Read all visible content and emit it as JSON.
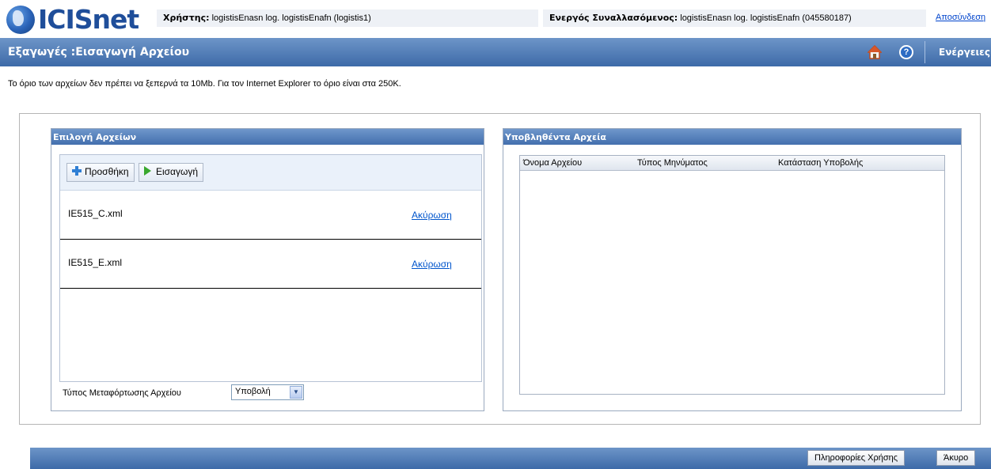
{
  "header": {
    "logo_text": "ICISnet",
    "user_label": "Χρήστης:",
    "user_value": "logistisEnasn log. logistisEnafn (logistis1)",
    "trader_label": "Ενεργός Συναλλασόμενος:",
    "trader_value": "logistisEnasn log. logistisEnafn (045580187)",
    "logout_label": "Αποσύνδεση"
  },
  "titlebar": {
    "title": "Εξαγωγές :Εισαγωγή Αρχείου",
    "actions_label": "Ενέργειες",
    "help_glyph": "?"
  },
  "note": "Το όριο των αρχείων δεν πρέπει να ξεπερνά τα 10Mb. Για τον Internet Explorer το όριο είναι στα 250K.",
  "left_panel": {
    "title": "Επιλογή Αρχείων",
    "add_button": "Προσθήκη",
    "import_button": "Εισαγωγή",
    "files": [
      {
        "name": "IE515_C.xml",
        "cancel_label": "Ακύρωση"
      },
      {
        "name": "IE515_E.xml",
        "cancel_label": "Ακύρωση"
      }
    ],
    "transfer_type_label": "Τύπος Μεταφόρτωσης Αρχείου",
    "transfer_type_value": "Υποβολή"
  },
  "right_panel": {
    "title": "Υποβληθέντα Αρχεία",
    "columns": [
      "Όνομα Αρχείου",
      "Τύπος Μηνύματος",
      "Κατάσταση Υποβολής"
    ]
  },
  "footer": {
    "help_button": "Πληροφορίες Χρήσης",
    "cancel_button": "Άκυρο"
  },
  "colors": {
    "header_blue": "#3d6aa8",
    "link_blue": "#0055cc"
  }
}
